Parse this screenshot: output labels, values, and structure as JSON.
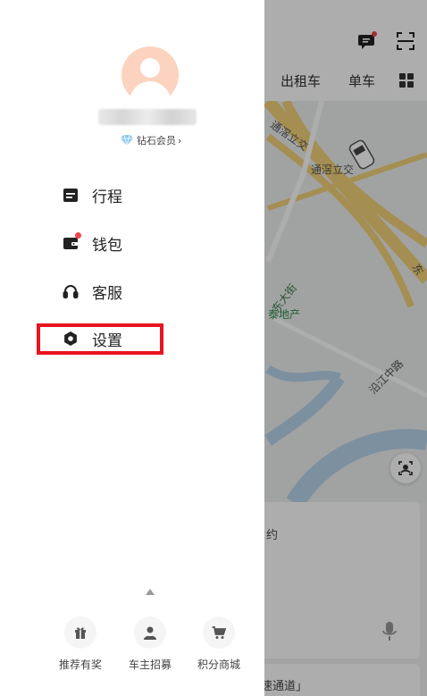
{
  "background": {
    "tabs": [
      "出租车",
      "单车"
    ],
    "map_labels": [
      "通滘立交",
      "通滘立交",
      "东大街",
      "沿江中路",
      "东"
    ],
    "map_poi": "泰地产",
    "card_text": "约",
    "card2_text": "速通道」"
  },
  "drawer": {
    "member_badge": "钻石会员",
    "member_chevron": "›",
    "menu": [
      {
        "label": "行程",
        "icon": "calendar-icon"
      },
      {
        "label": "钱包",
        "icon": "wallet-icon"
      },
      {
        "label": "客服",
        "icon": "headset-icon"
      },
      {
        "label": "设置",
        "icon": "gear-icon"
      }
    ],
    "bottom": [
      {
        "label": "推荐有奖",
        "icon": "gift-icon"
      },
      {
        "label": "车主招募",
        "icon": "driver-icon"
      },
      {
        "label": "积分商城",
        "icon": "cart-icon"
      }
    ]
  },
  "colors": {
    "highlight": "#e8141e",
    "badge_dot": "#f0454a",
    "avatar_bg": "#fbd3bf"
  }
}
